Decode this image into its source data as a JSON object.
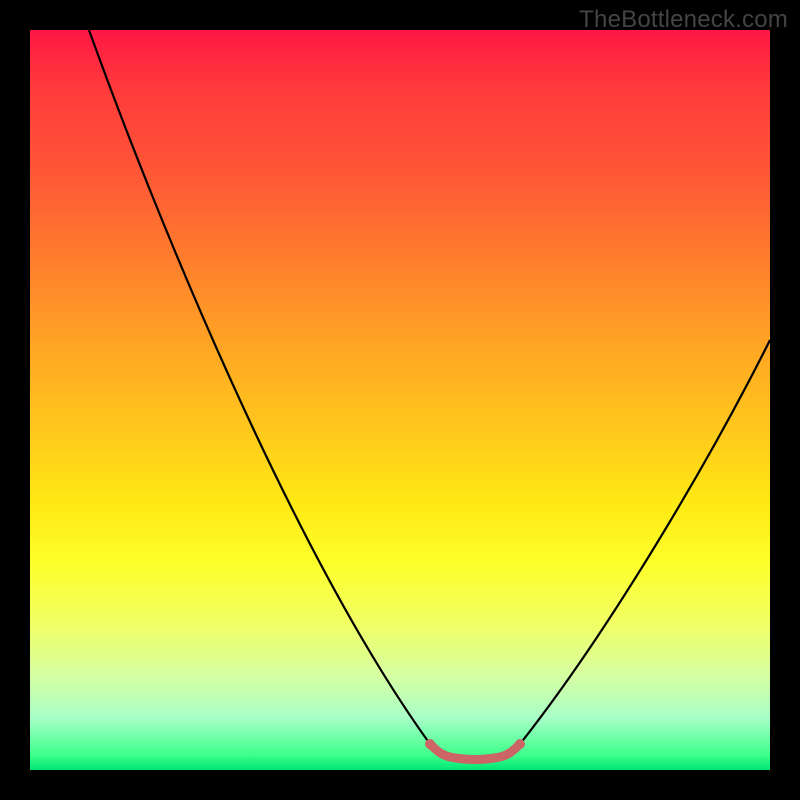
{
  "watermark": "TheBottleneck.com",
  "chart_data": {
    "type": "line",
    "title": "",
    "xlabel": "",
    "ylabel": "",
    "xlim": [
      0,
      100
    ],
    "ylim": [
      0,
      100
    ],
    "series": [
      {
        "name": "bottleneck-curve",
        "x": [
          8,
          12,
          16,
          20,
          24,
          28,
          32,
          36,
          40,
          44,
          48,
          52,
          54,
          55,
          56,
          58,
          60,
          62,
          64,
          66,
          70,
          74,
          78,
          82,
          86,
          90,
          94,
          98,
          100
        ],
        "y": [
          100,
          92,
          84,
          76,
          68,
          60,
          52,
          44,
          36,
          28,
          20,
          12,
          6,
          3,
          1,
          0,
          0,
          0,
          0,
          1,
          6,
          12,
          20,
          28,
          36,
          44,
          50,
          55,
          58
        ]
      },
      {
        "name": "bottom-highlight",
        "x": [
          55,
          56,
          58,
          60,
          62,
          64,
          66
        ],
        "y": [
          3,
          1,
          0,
          0,
          0,
          0,
          1
        ]
      }
    ],
    "colors": {
      "curve": "#000000",
      "highlight": "#cc6666",
      "gradient_top": "#ff1744",
      "gradient_mid": "#ffe914",
      "gradient_bottom": "#00e676"
    }
  }
}
